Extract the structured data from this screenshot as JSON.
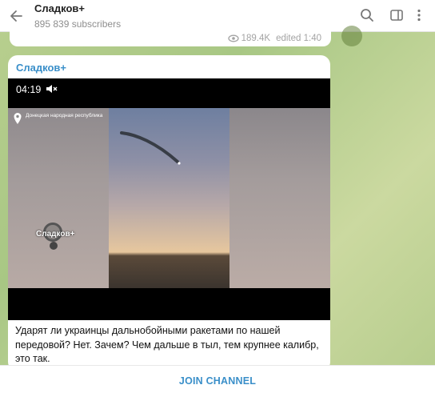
{
  "header": {
    "title": "Сладков+",
    "subscribers": "895 839 subscribers"
  },
  "prev_message": {
    "views": "189.4K",
    "edited": "edited 1:40"
  },
  "message": {
    "author": "Сладков+",
    "video": {
      "time": "04:19",
      "region_label": "Донецкая народная республика",
      "watermark": "Сладков+"
    },
    "text": "Ударят ли украинцы дальнобойными ракетами по нашей передовой? Нет. Зачем? Чем дальше в тыл, тем крупнее калибр, это так."
  },
  "footer": {
    "join_label": "JOIN CHANNEL"
  },
  "colors": {
    "accent": "#3a8fc9",
    "background": "#a8c784"
  }
}
